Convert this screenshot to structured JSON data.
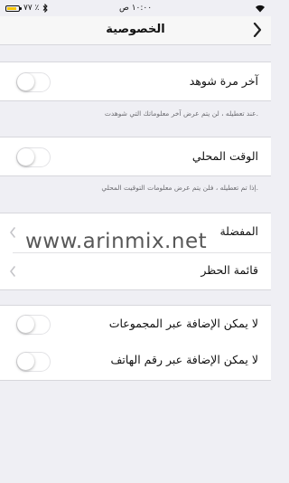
{
  "status_bar": {
    "time": "١٠:٠٠ ص",
    "battery_percent": "٧٧ ٪",
    "battery_level": 0.77
  },
  "header": {
    "title": "الخصوصية"
  },
  "sections": {
    "last_seen": {
      "label": "آخر مرة شوهد",
      "footer": ".عند تعطيله ، لن يتم عرض آخر معلوماتك التي شوهدت",
      "enabled": false
    },
    "local_time": {
      "label": "الوقت المحلي",
      "footer": ".إذا تم تعطيله ، فلن يتم عرض معلومات التوقيت المحلي",
      "enabled": false
    },
    "lists": {
      "favorites": "المفضلة",
      "block_list": "قائمة الحظر"
    },
    "adding": {
      "groups_label": "لا يمكن الإضافة عبر المجموعات",
      "phone_label": "لا يمكن الإضافة عبر رقم الهاتف",
      "groups_enabled": false,
      "phone_enabled": false
    }
  },
  "watermark": "www.arinmix.net",
  "icons": {
    "back": "chevron-right-icon",
    "disclosure": "chevron-left-icon",
    "wifi": "wifi-icon",
    "bluetooth": "bluetooth-icon",
    "battery": "battery-icon"
  }
}
